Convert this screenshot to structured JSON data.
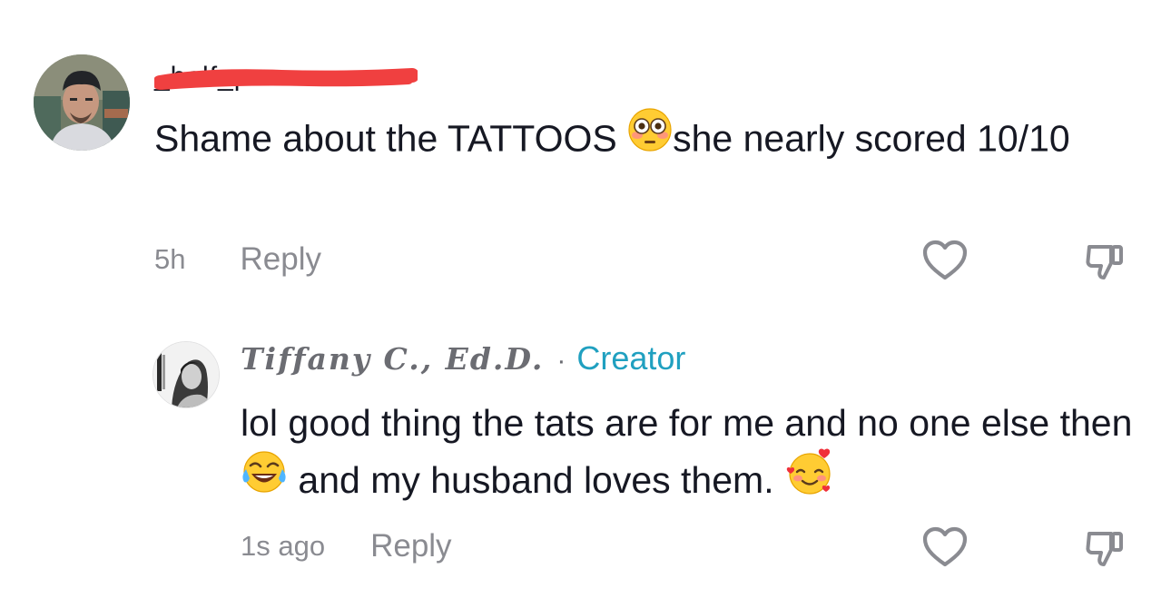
{
  "comments": [
    {
      "username": "_half_pour",
      "text_part1": "Shame about the TATTOOS ",
      "emoji_1": "flushed-face-emoji",
      "text_part2": "she nearly scored 10/10",
      "time": "5h",
      "reply_label": "Reply",
      "like_icon": "heart-outline-icon",
      "dislike_icon": "thumbs-down-outline-icon"
    },
    {
      "username": "Tiffany C., Ed.D.",
      "separator": "·",
      "badge": "Creator",
      "text_part1": "lol good thing the tats are for me and no one else then ",
      "emoji_1": "face-with-tears-of-joy-emoji",
      "text_part2": " and my husband loves them. ",
      "emoji_2": "smiling-face-with-hearts-emoji",
      "time": "1s ago",
      "reply_label": "Reply",
      "like_icon": "heart-outline-icon",
      "dislike_icon": "thumbs-down-outline-icon"
    }
  ],
  "colors": {
    "text": "#161823",
    "meta": "#8a8b91",
    "creator_badge": "#20a0c0",
    "redaction": "#f04040",
    "icon_stroke": "#8a8b91"
  }
}
